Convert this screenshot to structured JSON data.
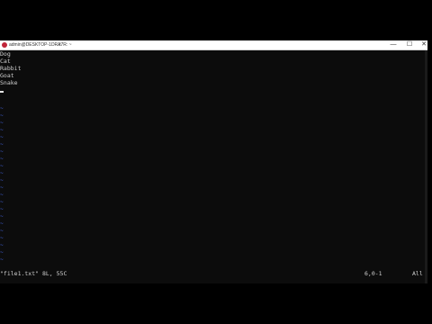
{
  "window": {
    "title": "admin@DESKTOP-1DRA7R: ~",
    "title_chevron": "∨",
    "min_label": "—",
    "max_label": "☐",
    "close_label": "✕",
    "icon": "terminal-app-icon"
  },
  "buffer": {
    "lines": [
      "Dog",
      "Cat",
      "Rabbit",
      "Goat",
      "Snake"
    ],
    "tilde": "~"
  },
  "status": {
    "file_info": "\"file1.txt\" 8L, 55C",
    "position": "6,0-1",
    "scroll": "All"
  },
  "colors": {
    "tilde": "#3f5fd8",
    "text": "#cfcfcf",
    "background": "#0c0c0c"
  }
}
